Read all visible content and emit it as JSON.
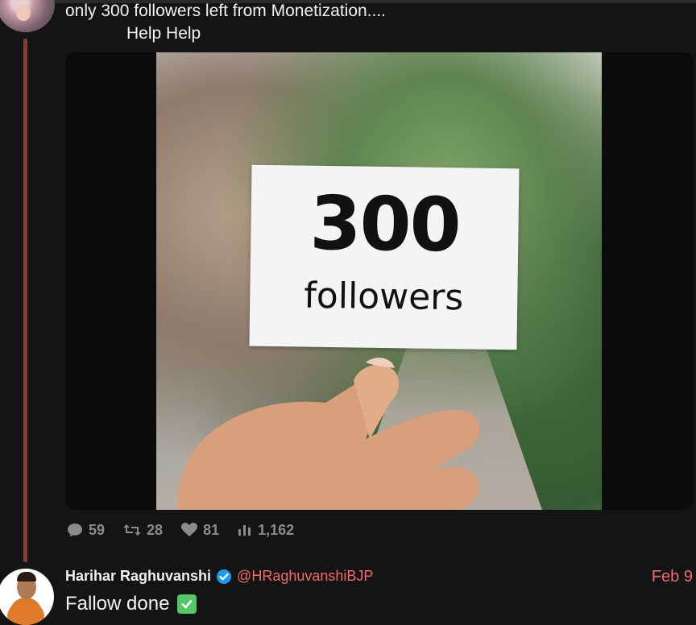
{
  "tweet": {
    "text_line1": "only 300 followers left from Monetization....",
    "text_line2": "Help Help",
    "image_text": {
      "number": "300",
      "word": "followers"
    },
    "stats": {
      "replies": "59",
      "retweets": "28",
      "likes": "81",
      "views": "1,162"
    }
  },
  "reply": {
    "author_name": "Harihar Raghuvanshi",
    "handle": "@HRaghuvanshiBJP",
    "date": "Feb 9",
    "text": "Fallow done"
  },
  "colors": {
    "background": "#141414",
    "thread_line": "#8a3a38",
    "handle_accent": "#f26b6b",
    "verified_badge": "#1d9bf0",
    "check_green": "#56c768"
  },
  "icons": [
    "reply-icon",
    "retweet-icon",
    "heart-icon",
    "views-icon",
    "verified-badge-icon",
    "check-box-icon"
  ]
}
